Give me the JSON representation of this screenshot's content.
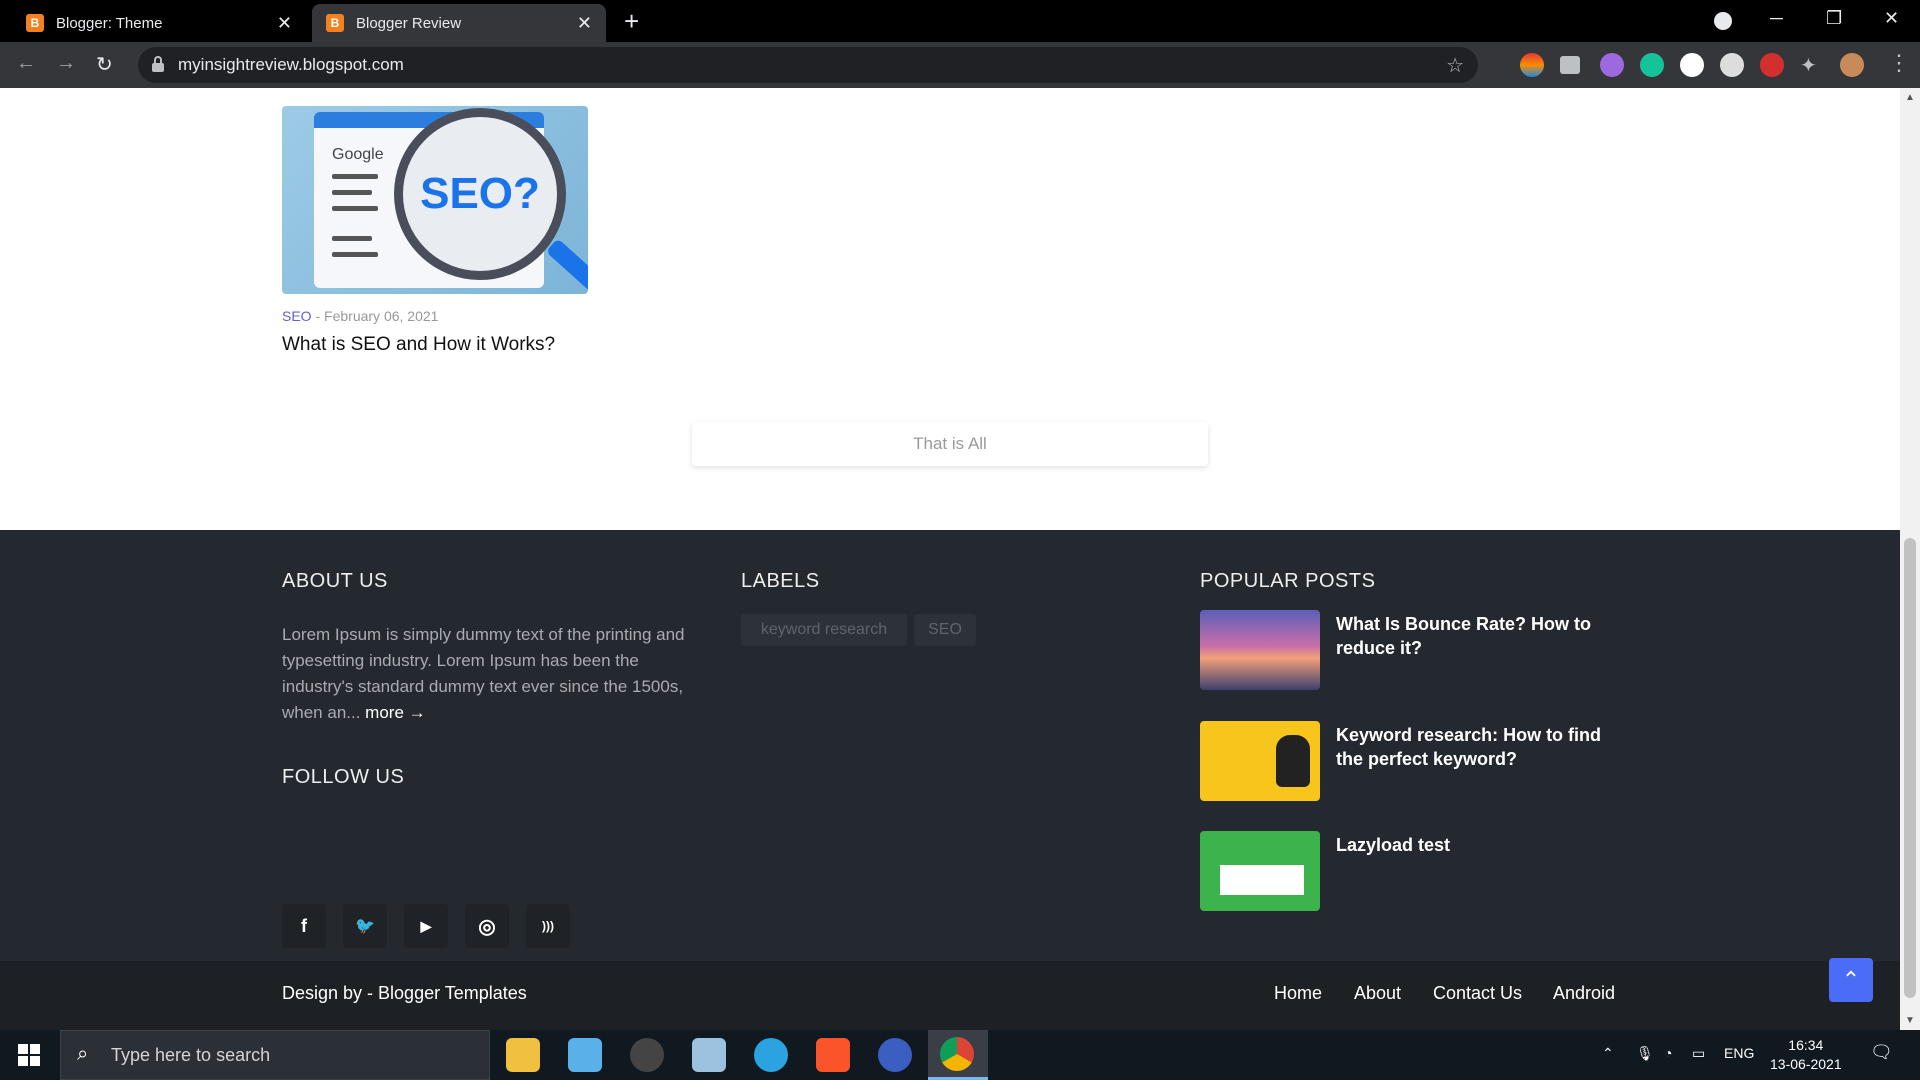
{
  "browser": {
    "tabs": [
      {
        "title": "Blogger: Theme",
        "favicon": "B"
      },
      {
        "title": "Blogger Review",
        "favicon": "B"
      }
    ],
    "url": "myinsightreview.blogspot.com"
  },
  "post": {
    "image_caption": "SEO?",
    "image_brand": "Google",
    "label": "SEO",
    "separator": " - ",
    "date": "February 06, 2021",
    "title": "What is SEO and How it Works?"
  },
  "pagination": {
    "text": "That is All"
  },
  "footer": {
    "about": {
      "heading": "ABOUT US",
      "text": "Lorem Ipsum is simply dummy text of the printing and typesetting industry. Lorem Ipsum has been the industry's standard dummy text ever since the 1500s, when an... ",
      "more": "more →"
    },
    "follow": {
      "heading": "FOLLOW US",
      "icons": [
        "facebook-icon",
        "twitter-icon",
        "youtube-icon",
        "instagram-icon",
        "rss-icon"
      ],
      "glyphs": [
        "f",
        "🐦",
        "▶",
        "◎",
        ")))"
      ]
    },
    "labels": {
      "heading": "LABELS",
      "tags": [
        "keyword research",
        "SEO"
      ]
    },
    "popular": {
      "heading": "POPULAR POSTS",
      "posts": [
        {
          "title": "What Is Bounce Rate? How to reduce it?"
        },
        {
          "title": "Keyword research: How to find the perfect keyword?"
        },
        {
          "title": "Lazyload test"
        }
      ]
    },
    "credit": "Design by - Blogger Templates",
    "nav": [
      "Home",
      "About",
      "Contact Us",
      "Android"
    ]
  },
  "taskbar": {
    "search_placeholder": "Type here to search",
    "lang": "ENG",
    "time": "16:34",
    "date": "13-06-2021"
  },
  "colors": {
    "accent": "#4a6cf7",
    "footer_bg": "#24292f",
    "label_link": "#5b63d3"
  }
}
